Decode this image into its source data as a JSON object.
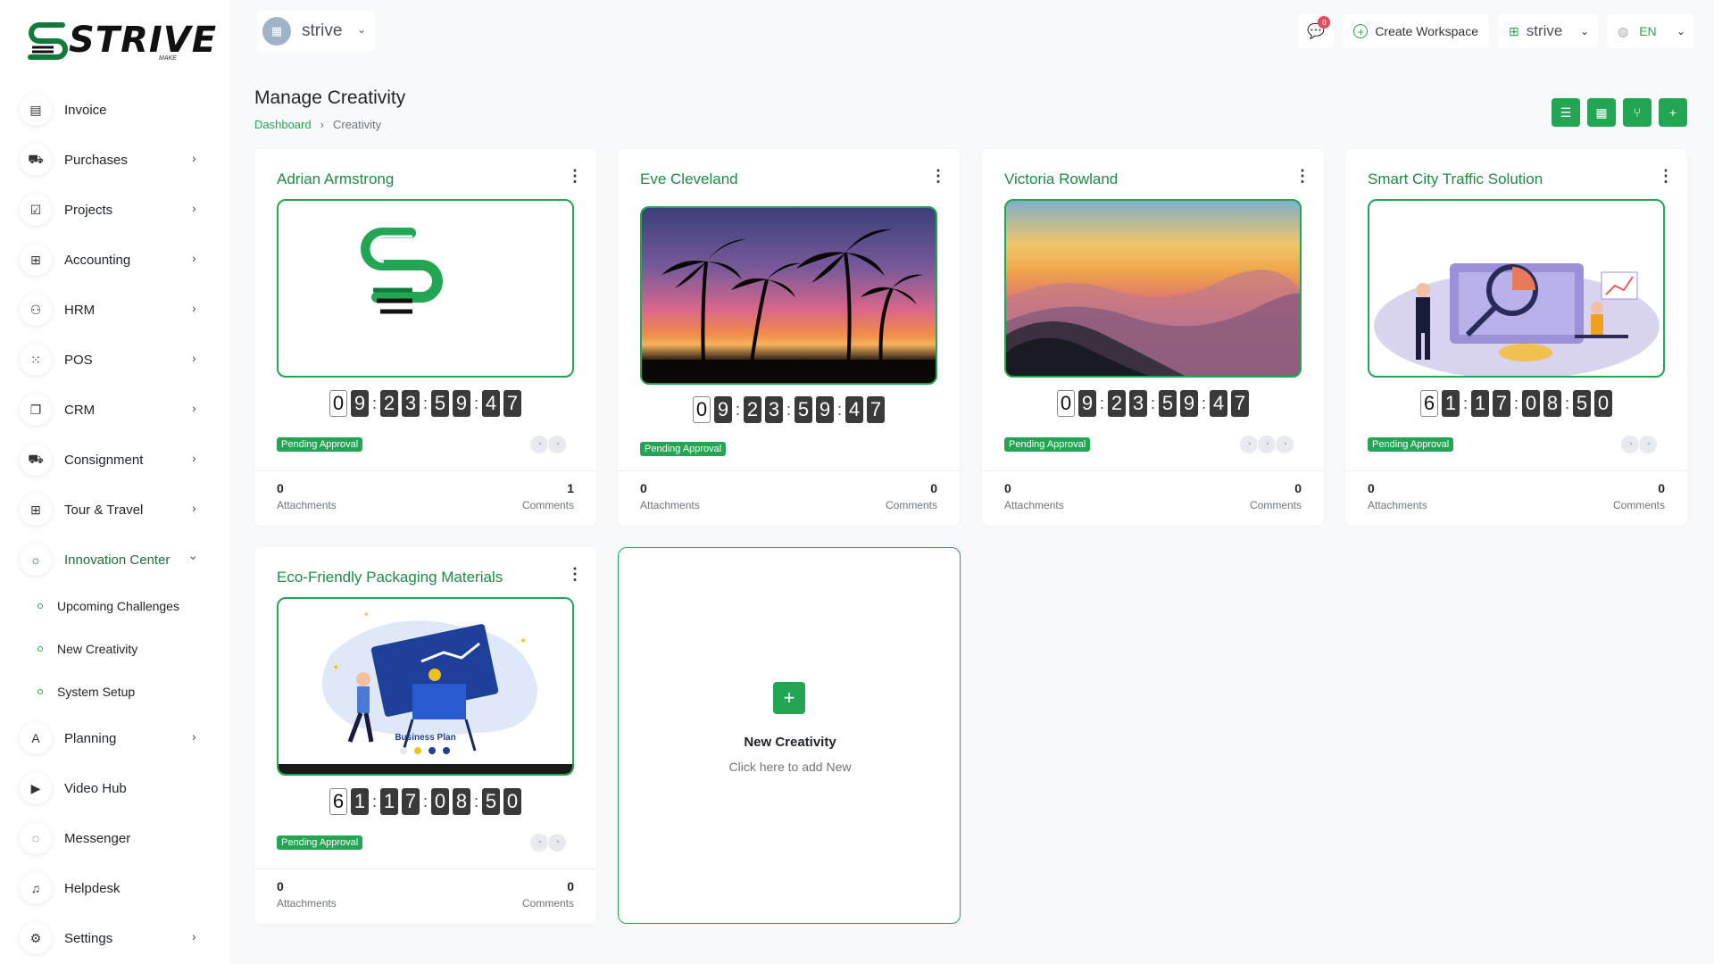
{
  "brand": {
    "name": "STRIVE",
    "sub": "MAKE"
  },
  "sidebar": {
    "items": [
      {
        "label": "Invoice",
        "icon": "document-icon",
        "chevron": false
      },
      {
        "label": "Purchases",
        "icon": "cart-icon",
        "chevron": true
      },
      {
        "label": "Projects",
        "icon": "checkbox-icon",
        "chevron": true
      },
      {
        "label": "Accounting",
        "icon": "grid-icon",
        "chevron": true
      },
      {
        "label": "HRM",
        "icon": "users-icon",
        "chevron": true
      },
      {
        "label": "POS",
        "icon": "dots-grid-icon",
        "chevron": true
      },
      {
        "label": "CRM",
        "icon": "layers-icon",
        "chevron": true
      },
      {
        "label": "Consignment",
        "icon": "truck-icon",
        "chevron": true
      },
      {
        "label": "Tour & Travel",
        "icon": "apps-icon",
        "chevron": true
      },
      {
        "label": "Innovation Center",
        "icon": "bulb-icon",
        "chevron": true
      },
      {
        "label": "Planning",
        "icon": "compass-icon",
        "chevron": true
      },
      {
        "label": "Video Hub",
        "icon": "video-icon",
        "chevron": false
      },
      {
        "label": "Messenger",
        "icon": "chat-icon",
        "chevron": false
      },
      {
        "label": "Helpdesk",
        "icon": "headset-icon",
        "chevron": false
      },
      {
        "label": "Settings",
        "icon": "gear-icon",
        "chevron": true
      }
    ],
    "sub_items": [
      "Upcoming Challenges",
      "New Creativity",
      "System Setup"
    ]
  },
  "topbar": {
    "workspace": "strive",
    "notification_count": "0",
    "create_workspace": "Create Workspace",
    "workspace_select": "strive",
    "language": "EN"
  },
  "page": {
    "title": "Manage Creativity",
    "breadcrumb": [
      "Dashboard",
      "Creativity"
    ]
  },
  "cards": [
    {
      "title": "Adrian Armstrong",
      "timer": [
        "0",
        "9",
        "2",
        "3",
        "5",
        "9",
        "4",
        "7"
      ],
      "status": "Pending Approval",
      "attachments": "0",
      "attachments_label": "Attachments",
      "comments": "1",
      "comments_label": "Comments"
    },
    {
      "title": "Eve Cleveland",
      "timer": [
        "0",
        "9",
        "2",
        "3",
        "5",
        "9",
        "4",
        "7"
      ],
      "status": "Pending Approval",
      "attachments": "0",
      "attachments_label": "Attachments",
      "comments": "0",
      "comments_label": "Comments"
    },
    {
      "title": "Victoria Rowland",
      "timer": [
        "0",
        "9",
        "2",
        "3",
        "5",
        "9",
        "4",
        "7"
      ],
      "status": "Pending Approval",
      "attachments": "0",
      "attachments_label": "Attachments",
      "comments": "0",
      "comments_label": "Comments"
    },
    {
      "title": "Smart City Traffic Solution",
      "timer": [
        "6",
        "1",
        "1",
        "7",
        "0",
        "8",
        "5",
        "0"
      ],
      "status": "Pending Approval",
      "attachments": "0",
      "attachments_label": "Attachments",
      "comments": "0",
      "comments_label": "Comments"
    },
    {
      "title": "Eco-Friendly Packaging Materials",
      "timer": [
        "6",
        "1",
        "1",
        "7",
        "0",
        "8",
        "5",
        "0"
      ],
      "status": "Pending Approval",
      "attachments": "0",
      "attachments_label": "Attachments",
      "comments": "0",
      "comments_label": "Comments",
      "image_caption": "Business Plan"
    }
  ],
  "new_card": {
    "title": "New Creativity",
    "subtitle": "Click here to add New"
  },
  "colors": {
    "accent": "#22a653",
    "title_green": "#1e8a46",
    "badge_red": "#e74a5c"
  }
}
